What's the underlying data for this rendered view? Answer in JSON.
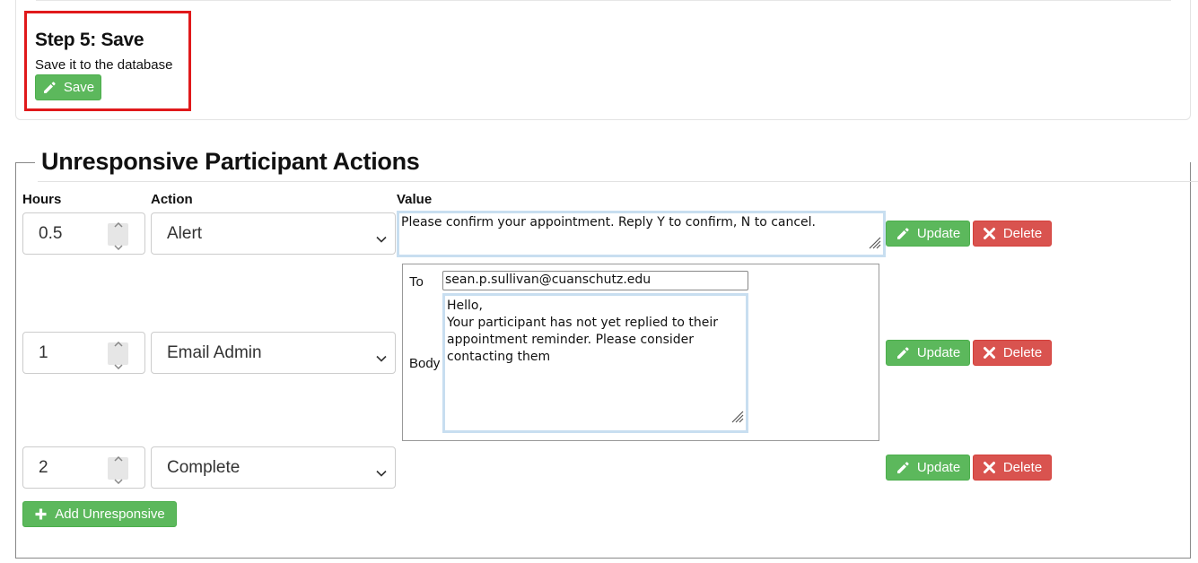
{
  "step": {
    "title": "Step 5: Save",
    "subtitle": "Save it to the database",
    "save_label": "Save"
  },
  "section": {
    "legend": "Unresponsive Participant Actions",
    "columns": {
      "hours": "Hours",
      "action": "Action",
      "value": "Value"
    }
  },
  "rows": [
    {
      "hours": "0.5",
      "action": "Alert",
      "value": "Please confirm your appointment. Reply Y to confirm, N to cancel."
    },
    {
      "hours": "1",
      "action": "Email Admin",
      "to_label": "To",
      "body_label": "Body",
      "to": "sean.p.sullivan@cuanschutz.edu",
      "body": "Hello,\nYour participant has not yet replied to their appointment reminder. Please consider contacting them"
    },
    {
      "hours": "2",
      "action": "Complete"
    }
  ],
  "buttons": {
    "update_label": "Update",
    "delete_label": "Delete",
    "add_label": "Add Unresponsive"
  },
  "colors": {
    "success": "#5cb85c",
    "danger": "#d9534f",
    "highlight": "#e0191b"
  }
}
